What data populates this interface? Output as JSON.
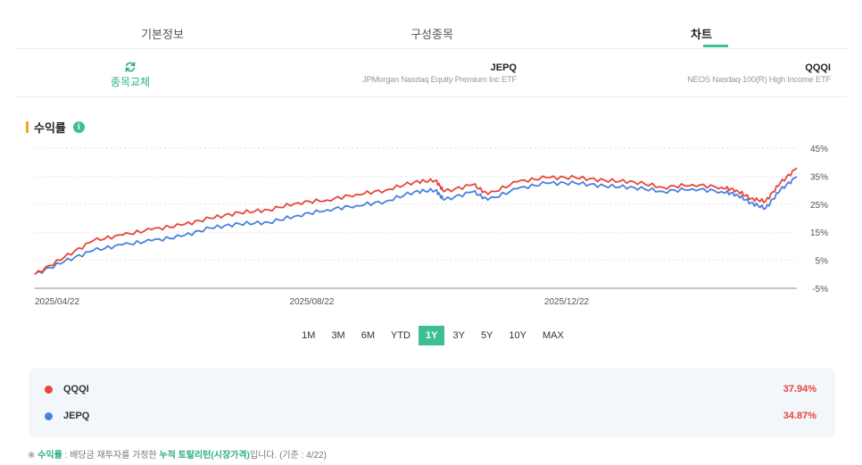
{
  "tabs": [
    {
      "label": "기본정보"
    },
    {
      "label": "구성종목"
    },
    {
      "label": "차트"
    }
  ],
  "compare": {
    "swap_label": "종목교체",
    "fund_a": {
      "ticker": "JEPQ",
      "name": "JPMorgan Nasdaq Equity Premium Inc ETF"
    },
    "fund_b": {
      "ticker": "QQQI",
      "name": "NEOS Nasdaq-100(R) High Income ETF"
    }
  },
  "section": {
    "title": "수익률",
    "info_icon": "info-icon"
  },
  "periods": [
    "1M",
    "3M",
    "6M",
    "YTD",
    "1Y",
    "3Y",
    "5Y",
    "10Y",
    "MAX"
  ],
  "active_period": "1Y",
  "chart_data": {
    "type": "line",
    "x": [
      "2025/04/22",
      "2025/05/06",
      "2025/05/20",
      "2025/06/03",
      "2025/06/17",
      "2025/07/01",
      "2025/07/15",
      "2025/07/29",
      "2025/08/12",
      "2025/08/26",
      "2025/09/09",
      "2025/09/23",
      "2025/10/07",
      "2025/10/21",
      "2025/10/31",
      "2025/11/04",
      "2025/11/18",
      "2025/11/25",
      "2025/12/09",
      "2025/12/23",
      "2026/01/06",
      "2026/01/20",
      "2026/02/03",
      "2026/02/17",
      "2026/03/03",
      "2026/03/17",
      "2026/03/24",
      "2026/03/31",
      "2026/04/07",
      "2026/04/14",
      "2026/04/22"
    ],
    "x_ticks": [
      "2025/04/22",
      "2025/08/22",
      "2025/12/22"
    ],
    "y_ticks": [
      "45%",
      "35%",
      "25%",
      "15%",
      "5%",
      "-5%"
    ],
    "ylim": [
      -5,
      45
    ],
    "grid": true,
    "series": [
      {
        "name": "QQQI",
        "color": "#e8453c",
        "values": [
          0,
          6,
          12,
          14,
          16,
          17.5,
          20,
          22,
          23,
          25.5,
          26.5,
          28.5,
          30,
          33,
          33.5,
          29.5,
          32,
          28.5,
          33,
          34.5,
          34.5,
          33.5,
          33,
          31,
          32,
          31,
          30,
          27,
          26,
          32.5,
          37.94
        ]
      },
      {
        "name": "JEPQ",
        "color": "#4a7fe0",
        "values": [
          0,
          4.5,
          8.5,
          10.5,
          12,
          13.5,
          16.5,
          18,
          18.5,
          21,
          23,
          24.5,
          26,
          29.5,
          30,
          26.5,
          29.5,
          26.5,
          30.5,
          32.5,
          32.5,
          31.5,
          31,
          29.5,
          30.5,
          29.5,
          28.5,
          25.5,
          23.5,
          30,
          34.87
        ]
      }
    ]
  },
  "legend": [
    {
      "name": "QQQI",
      "color": "#e8453c",
      "value": "37.94%"
    },
    {
      "name": "JEPQ",
      "color": "#4a7fe0",
      "value": "34.87%"
    }
  ],
  "footnote": {
    "prefix": "※ ",
    "term": "수익률",
    "mid": " : 배당금 재투자를 가정한 ",
    "highlight": "누적 토탈리턴(시장가격)",
    "suffix": "입니다. (기준 : 4/22)"
  }
}
